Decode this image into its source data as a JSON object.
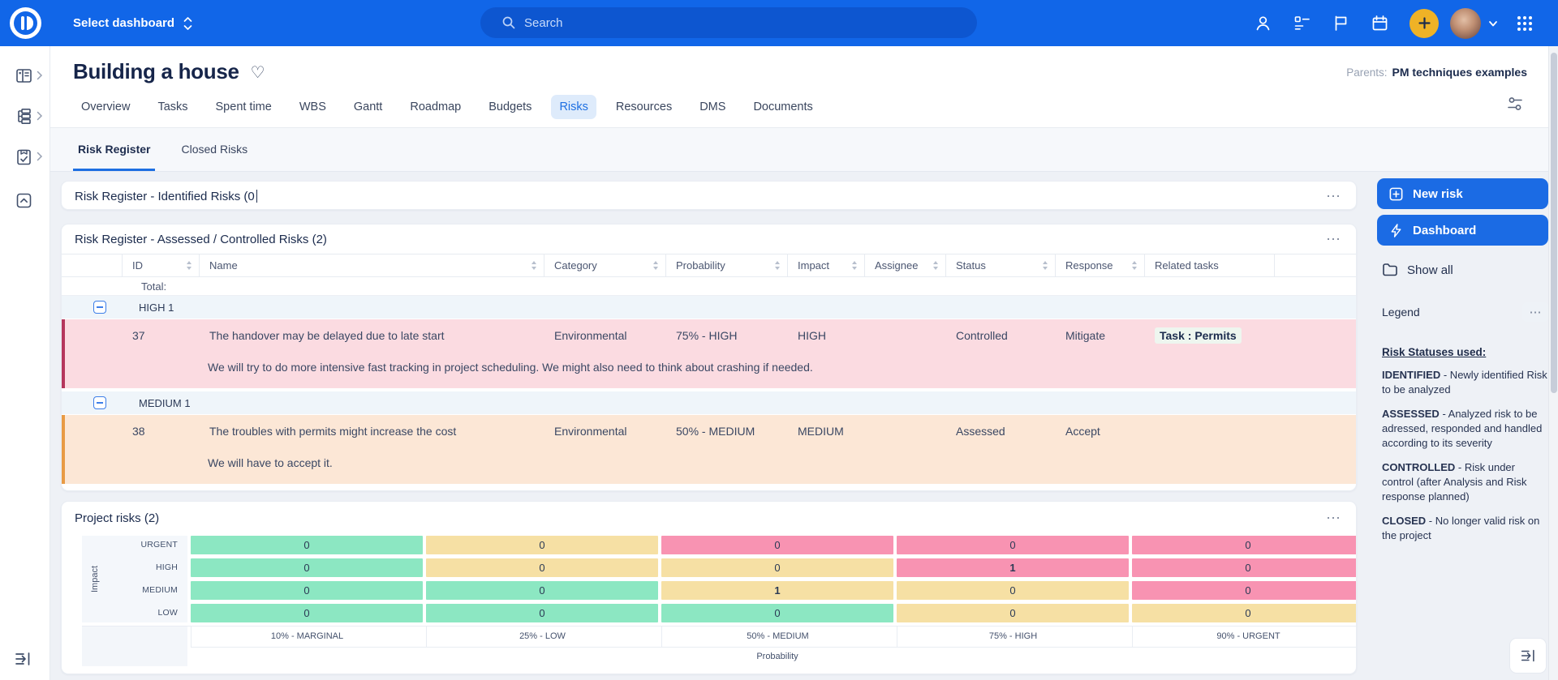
{
  "icons": {
    "heart": "♡",
    "ellipsis": "⋯"
  },
  "topbar": {
    "dashboard_selector": "Select dashboard",
    "search_placeholder": "Search",
    "colors": {
      "bar": "#1166E8",
      "search_pill": "#0D56D0",
      "plus_button": "#EFB226"
    }
  },
  "header": {
    "title": "Building a house",
    "parents_label": "Parents:",
    "parents_value": "PM techniques examples"
  },
  "tabs": {
    "items": [
      "Overview",
      "Tasks",
      "Spent time",
      "WBS",
      "Gantt",
      "Roadmap",
      "Budgets",
      "Risks",
      "Resources",
      "DMS",
      "Documents"
    ],
    "active": "Risks"
  },
  "subtabs": {
    "items": [
      "Risk Register",
      "Closed Risks"
    ],
    "active": "Risk Register"
  },
  "identified_panel": {
    "title": "Risk Register - Identified Risks (0"
  },
  "assessed_panel": {
    "title": "Risk Register - Assessed / Controlled Risks (2)",
    "columns": {
      "id": "ID",
      "name": "Name",
      "category": "Category",
      "probability": "Probability",
      "impact": "Impact",
      "assignee": "Assignee",
      "status": "Status",
      "response": "Response",
      "related": "Related tasks"
    },
    "total_label": "Total:",
    "groups": [
      {
        "label": "HIGH 1",
        "row": {
          "id": "37",
          "name": "The handover may be delayed due to late start",
          "category": "Environmental",
          "probability": "75% - HIGH",
          "impact": "HIGH",
          "assignee": "",
          "status": "Controlled",
          "response": "Mitigate",
          "related_task": "Task : Permits",
          "description": "We will try to do more intensive fast tracking in project scheduling. We might also need to think about crashing if needed.",
          "row_color": "#FBDBE1",
          "stripe_color": "#B5365C"
        }
      },
      {
        "label": "MEDIUM 1",
        "row": {
          "id": "38",
          "name": "The troubles with permits might increase the cost",
          "category": "Environmental",
          "probability": "50% - MEDIUM",
          "impact": "MEDIUM",
          "assignee": "",
          "status": "Assessed",
          "response": "Accept",
          "related_task": "",
          "description": "We will have to accept it.",
          "row_color": "#FCE7D6",
          "stripe_color": "#E89B45"
        }
      }
    ]
  },
  "matrix_panel": {
    "title": "Project risks (2)",
    "impact_axis": "Impact",
    "probability_axis": "Probability",
    "row_labels": [
      "URGENT",
      "HIGH",
      "MEDIUM",
      "LOW"
    ],
    "col_labels": [
      "10% - MARGINAL",
      "25% - LOW",
      "50% - MEDIUM",
      "75% - HIGH",
      "90% - URGENT"
    ],
    "values": [
      [
        "0",
        "0",
        "0",
        "0",
        "0"
      ],
      [
        "0",
        "0",
        "0",
        "1",
        "0"
      ],
      [
        "0",
        "0",
        "1",
        "0",
        "0"
      ],
      [
        "0",
        "0",
        "0",
        "0",
        "0"
      ]
    ],
    "cell_colors": [
      [
        "green",
        "yellow",
        "pink",
        "pink",
        "pink"
      ],
      [
        "green",
        "yellow",
        "yellow",
        "pink",
        "pink"
      ],
      [
        "green",
        "green",
        "yellow",
        "yellow",
        "pink"
      ],
      [
        "green",
        "green",
        "green",
        "yellow",
        "yellow"
      ]
    ],
    "palette": {
      "green": "#8CE7C2",
      "yellow": "#F6E0A4",
      "pink": "#F893B2"
    }
  },
  "right_panel": {
    "new_risk_button": "New risk",
    "dashboard_button": "Dashboard",
    "show_all": "Show all",
    "legend_title": "Legend",
    "legend_heading": "Risk Statuses used:",
    "legend_items": [
      {
        "term": "IDENTIFIED",
        "desc": "- Newly identified Risk to be analyzed"
      },
      {
        "term": "ASSESSED",
        "desc": "- Analyzed risk to be adressed, responded and handled according to its severity"
      },
      {
        "term": "CONTROLLED",
        "desc": "- Risk under control (after Analysis and Risk response planned)"
      },
      {
        "term": "CLOSED",
        "desc": "- No longer valid risk on the project"
      }
    ],
    "accent_color": "#1B6BE4"
  }
}
